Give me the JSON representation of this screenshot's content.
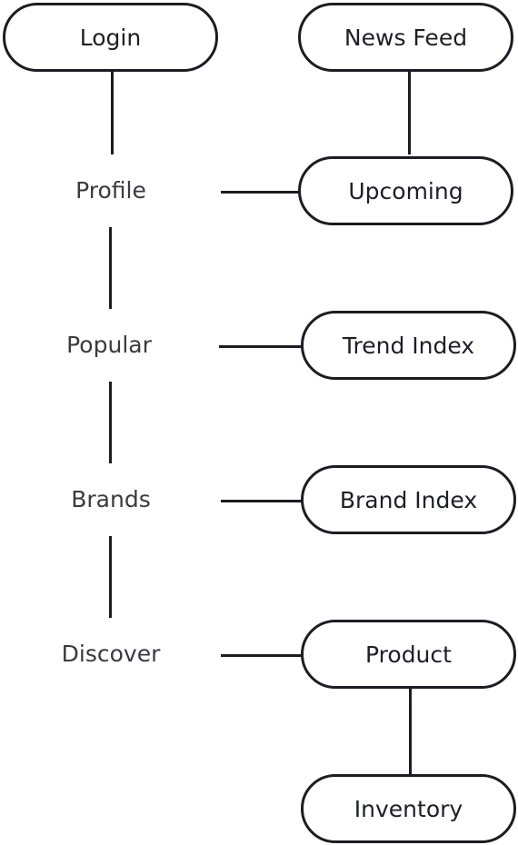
{
  "nodes": {
    "login": "Login",
    "news_feed": "News Feed",
    "profile": "Profile",
    "upcoming": "Upcoming",
    "popular": "Popular",
    "trend_index": "Trend Index",
    "brands": "Brands",
    "brand_index": "Brand Index",
    "discover": "Discover",
    "product": "Product",
    "inventory": "Inventory"
  },
  "colors": {
    "stroke": "#1c1c24",
    "text": "#1e1e28",
    "label_text": "#3a3a3f"
  }
}
